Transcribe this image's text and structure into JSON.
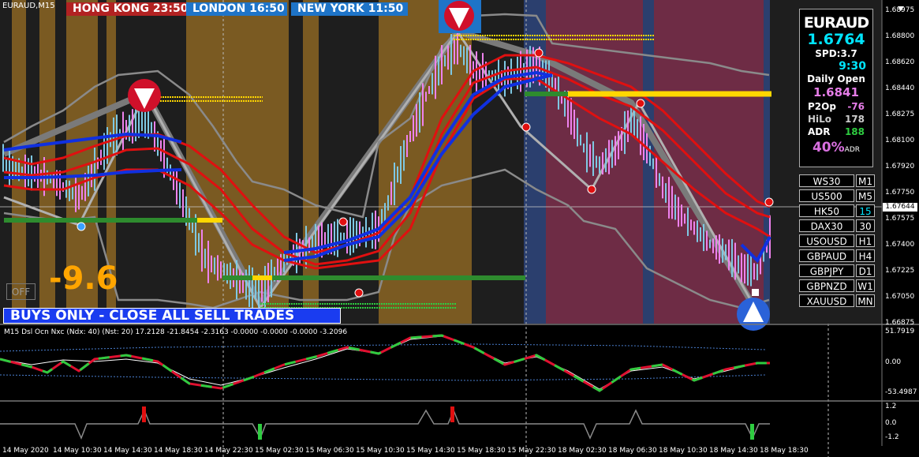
{
  "symbol_tag": "EURAUD,M15",
  "sessions": {
    "hong_kong": "HONG KONG  23:50",
    "london": "LONDON   16:50",
    "new_york": "NEW YORK  11:50"
  },
  "info_panel": {
    "symbol": "EURAUD",
    "price": "1.6764",
    "spread": "SPD:3.7",
    "timer": "9:30",
    "daily_open_label": "Daily Open",
    "daily_open_value": "1.6841",
    "p2op_label": "P2Op",
    "p2op_value": "-76",
    "hilo_label": "HiLo",
    "hilo_value": "178",
    "adr_label": "ADR",
    "adr_value": "188",
    "adr_pct": "40%",
    "adr_pct_sup": "ADR"
  },
  "symbol_buttons": [
    {
      "symbol": "WS30",
      "tf": "M1"
    },
    {
      "symbol": "US500",
      "tf": "M5"
    },
    {
      "symbol": "HK50",
      "tf": "15"
    },
    {
      "symbol": "DAX30",
      "tf": "30"
    },
    {
      "symbol": "USOUSD",
      "tf": "H1"
    },
    {
      "symbol": "GBPAUD",
      "tf": "H4"
    },
    {
      "symbol": "GBPJPY",
      "tf": "D1"
    },
    {
      "symbol": "GBPNZD",
      "tf": "W1"
    },
    {
      "symbol": "XAUUSD",
      "tf": "MN"
    }
  ],
  "big_value": "-9.6",
  "off_button": "OFF",
  "signal_banner": "BUYS ONLY - CLOSE ALL SELL TRADES",
  "indicator_label": "M15 Dsl Ocn Nxc (Ndx: 40) (Nst: 20) 17.2128 -21.8454 -2.3163 -0.0000 -0.0000 -0.0000 -3.2096",
  "current_price_label": "1.67644",
  "price_axis": [
    "1.68975",
    "1.68800",
    "1.68620",
    "1.68440",
    "1.68275",
    "1.68100",
    "1.67920",
    "1.67750",
    "1.67575",
    "1.67400",
    "1.67225",
    "1.67050",
    "1.66875"
  ],
  "osc_axis": [
    "51.7919",
    "0.00",
    "-53.4987"
  ],
  "hist_axis": [
    "1.2",
    "0.0",
    "-1.2"
  ],
  "time_axis": [
    "14 May 2020",
    "14 May 10:30",
    "14 May 14:30",
    "14 May 18:30",
    "14 May 22:30",
    "15 May 02:30",
    "15 May 06:30",
    "15 May 10:30",
    "15 May 14:30",
    "15 May 18:30",
    "15 May 22:30",
    "18 May 02:30",
    "18 May 06:30",
    "18 May 10:30",
    "18 May 14:30",
    "18 May 18:30"
  ],
  "colors": {
    "background": "#000000",
    "chart_bg": "#1e1e1e",
    "session_gold": "#7a5a22",
    "session_maroon": "#6e2c45",
    "session_navy": "#2b3f6e",
    "red_band": "#e01010",
    "blue_band": "#1030e0",
    "grey_line": "#8a8a8a",
    "green_bar": "#2e8b2e",
    "yellow_bar": "#ffd700",
    "hk_label": "#b22222",
    "ldn_label": "#1e74c8"
  }
}
